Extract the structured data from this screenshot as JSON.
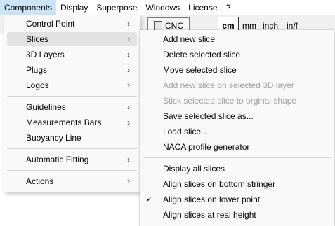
{
  "menubar": {
    "items": [
      "Components",
      "Display",
      "Superpose",
      "Windows",
      "License",
      "?"
    ]
  },
  "toolbar": {
    "cnc_label": "CNC",
    "units": [
      "cm",
      "mm",
      "inch",
      "in/f"
    ]
  },
  "components_menu": {
    "items": [
      {
        "label": "Control Point",
        "submenu": true
      },
      {
        "label": "Slices",
        "submenu": true,
        "highlighted": true
      },
      {
        "label": "3D Layers",
        "submenu": true
      },
      {
        "label": "Plugs",
        "submenu": true
      },
      {
        "label": "Logos",
        "submenu": true
      },
      {
        "label": "Guidelines",
        "submenu": true
      },
      {
        "label": "Measurements Bars",
        "submenu": true
      },
      {
        "label": "Buoyancy Line",
        "submenu": false
      },
      {
        "label": "Automatic Fitting",
        "submenu": true
      },
      {
        "label": "Actions",
        "submenu": true
      }
    ]
  },
  "slices_menu": {
    "items": [
      {
        "label": "Add new slice",
        "enabled": true
      },
      {
        "label": "Delete selected slice",
        "enabled": true
      },
      {
        "label": "Move selected slice",
        "enabled": true
      },
      {
        "label": "Add new slice on selected 3D layer",
        "enabled": false
      },
      {
        "label": "Stick selected slice to orginal shape",
        "enabled": false
      },
      {
        "label": "Save selected slice as...",
        "enabled": true
      },
      {
        "label": "Load slice...",
        "enabled": true
      },
      {
        "label": "NACA profile generator",
        "enabled": true
      },
      {
        "label": "Display all slices",
        "enabled": true
      },
      {
        "label": "Align slices on bottom stringer",
        "enabled": true
      },
      {
        "label": "Align slices on lower point",
        "enabled": true,
        "checked": true
      },
      {
        "label": "Align slices at real height",
        "enabled": true
      }
    ],
    "check_glyph": "✓"
  },
  "icons": {
    "submenu_arrow": "›"
  }
}
